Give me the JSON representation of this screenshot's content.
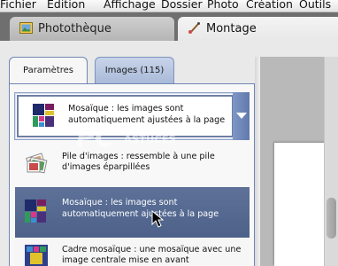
{
  "menu": [
    "Fichier",
    "Edition",
    "Affichage",
    "Dossier",
    "Photo",
    "Création",
    "Outils"
  ],
  "top_tabs": {
    "phototheque": {
      "label": "Photothèque",
      "icon": "photo-library-icon"
    },
    "montage": {
      "label": "Montage",
      "icon": "brush-icon"
    }
  },
  "sub_tabs": {
    "parametres": "Paramètres",
    "images": "Images (115)"
  },
  "layout_select": {
    "selected_line1": "Mosaïque : les images sont",
    "selected_line2": "automatiquement ajustées à la page",
    "icon": "mosaic-layout-icon"
  },
  "layout_options": [
    {
      "line1": "Pile d'images : ressemble à une pile",
      "line2": "d'images éparpillées",
      "icon": "photo-stack-icon"
    },
    {
      "line1": "Mosaïque : les images sont",
      "line2": "automatiquement ajustées à la page",
      "icon": "mosaic-layout-icon",
      "highlighted": true
    },
    {
      "line1": "Cadre mosaïque : une mosaïque avec une",
      "line2": "image centrale mise en avant",
      "icon": "framed-mosaic-icon"
    }
  ],
  "watermark": {
    "main": "PC",
    "sub": "ASTUCES"
  },
  "colors": {
    "selection": "#55698f",
    "accent_border": "#6f86b3",
    "tab_inactive": "#b0c0df"
  }
}
